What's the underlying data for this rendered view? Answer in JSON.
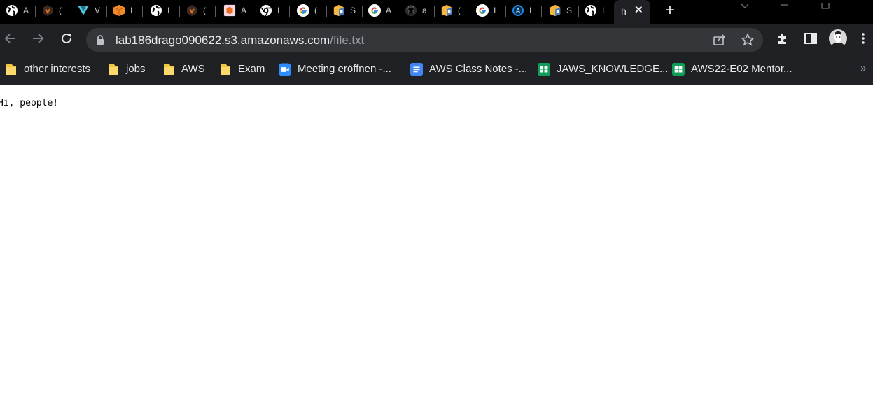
{
  "tabs": [
    {
      "icon": "globe-icon",
      "text": "A"
    },
    {
      "icon": "hex-dark-icon",
      "text": "("
    },
    {
      "icon": "v-logo-icon",
      "text": "V"
    },
    {
      "icon": "orange-cube-icon",
      "text": "I"
    },
    {
      "icon": "globe-icon",
      "text": "I"
    },
    {
      "icon": "hex-dark-icon",
      "text": "("
    },
    {
      "icon": "orange-hex-icon",
      "text": "A"
    },
    {
      "icon": "chrome-icon",
      "text": "I"
    },
    {
      "icon": "google-icon",
      "text": "("
    },
    {
      "icon": "aws-box-icon",
      "text": "S"
    },
    {
      "icon": "google-icon",
      "text": "A"
    },
    {
      "icon": "github-icon",
      "text": "a"
    },
    {
      "icon": "aws-box-icon",
      "text": "("
    },
    {
      "icon": "google-icon",
      "text": "I"
    },
    {
      "icon": "a-badge-icon",
      "text": "I"
    },
    {
      "icon": "aws-box-icon",
      "text": "S"
    },
    {
      "icon": "globe-icon",
      "text": "I"
    }
  ],
  "active_tab": {
    "icon": "none",
    "text": "h",
    "close": "✕"
  },
  "new_tab": "+",
  "address": {
    "host": "lab186drago090622.s3.amazonaws.com",
    "path": "/file.txt"
  },
  "bookmarks": [
    {
      "icon": "folder-icon",
      "label": "other interests"
    },
    {
      "icon": "folder-icon",
      "label": "jobs"
    },
    {
      "icon": "folder-icon",
      "label": "AWS"
    },
    {
      "icon": "folder-icon",
      "label": "Exam"
    },
    {
      "icon": "zoom-icon",
      "label": "Meeting eröffnen -..."
    },
    {
      "icon": "docs-icon",
      "label": "AWS Class Notes -..."
    },
    {
      "icon": "sheets-icon",
      "label": "JAWS_KNOWLEDGE..."
    },
    {
      "icon": "sheets-icon",
      "label": "AWS22-E02 Mentor..."
    }
  ],
  "bookmarks_more": "»",
  "page": {
    "text": "Hi, people!"
  },
  "colors": {
    "chrome_dark": "#202124",
    "tabstrip": "#000000",
    "omnibox": "#35363a",
    "text_light": "#e8eaed",
    "text_dim": "#9aa0a6",
    "folder": "#f4c542",
    "google_blue": "#4285f4",
    "sheets_green": "#0f9d58",
    "zoom_blue": "#2d8cff",
    "aws_orange": "#ff9900"
  }
}
